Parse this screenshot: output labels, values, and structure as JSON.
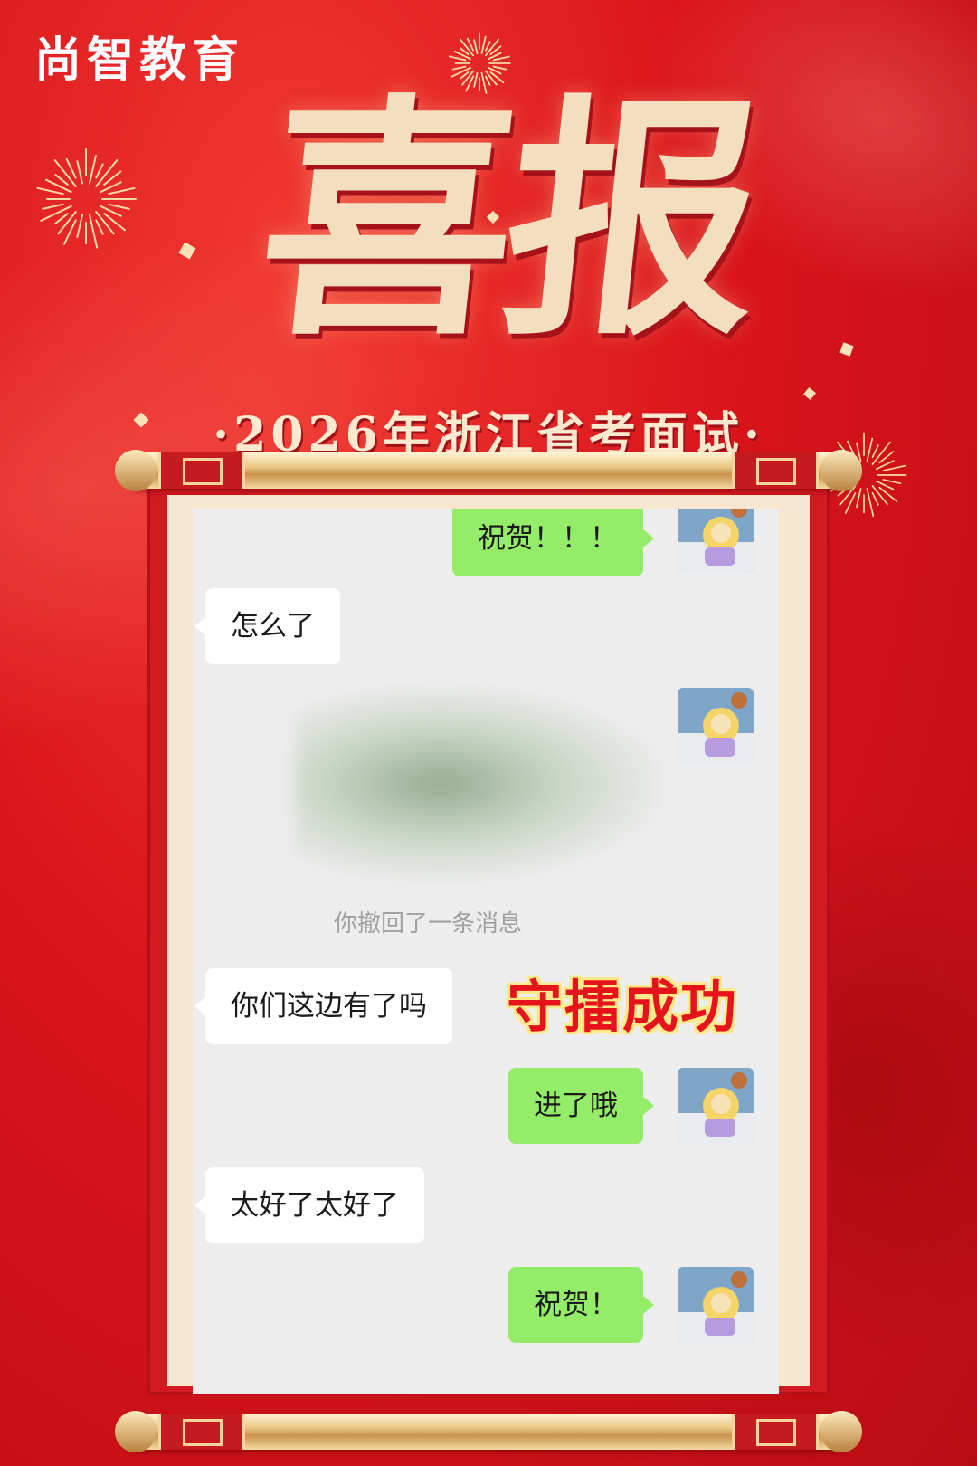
{
  "brand": {
    "name": "尚智教育"
  },
  "poster": {
    "headline": "喜报",
    "subtitle": "·2026年浙江省考面试·",
    "stamp": "守擂成功"
  },
  "colors": {
    "background": "#d9151b",
    "gold": "#f3dfbf",
    "outgoing_bubble": "#95ec69",
    "incoming_bubble": "#ffffff",
    "chat_bg": "#ededed"
  },
  "chat": {
    "messages": [
      {
        "side": "out",
        "text": "祝贺！！！"
      },
      {
        "side": "in",
        "text": "怎么了"
      },
      {
        "side": "out",
        "text": "",
        "blurred": true
      },
      {
        "side": "system",
        "text": "你撤回了一条消息"
      },
      {
        "side": "in",
        "text": "你们这边有了吗"
      },
      {
        "side": "out",
        "text": "进了哦"
      },
      {
        "side": "in",
        "text": "太好了太好了"
      },
      {
        "side": "out",
        "text": "祝贺！"
      }
    ],
    "avatar_icon": "cartoon-avatar-icon"
  }
}
